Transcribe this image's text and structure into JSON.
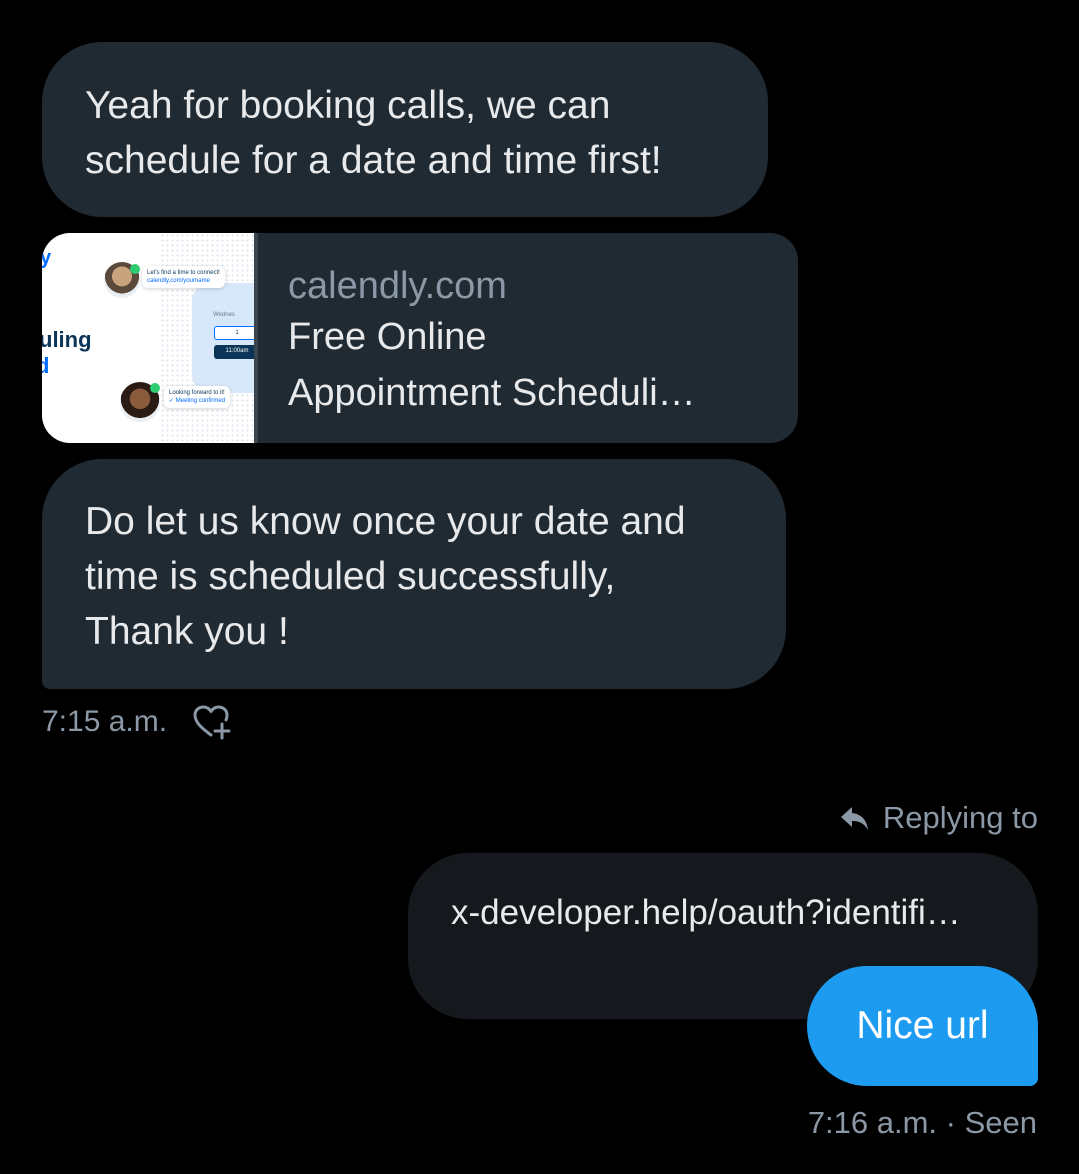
{
  "conversation": {
    "incoming": [
      {
        "text": "Yeah for booking calls, we can\nschedule for a date and time first!"
      },
      {
        "text": "Do let us know once your date and\ntime is scheduled successfully,\nThank you !"
      }
    ],
    "link_preview": {
      "domain": "calendly.com",
      "title": "Free Online\nAppointment Scheduli…",
      "thumbnail": {
        "word_fragment_top": "y",
        "word_fragment_mid": "uling",
        "word_fragment_low": "d",
        "bubble_top_line1": "Let's find a time to connect!",
        "bubble_top_line2": "calendly.com/yourname",
        "bubble_bottom_line1": "Looking forward to it!",
        "bubble_bottom_line2": "Meeting confirmed",
        "calendar_day": "Wednes",
        "slot_1": "1",
        "slot_2": "11:00am"
      }
    },
    "incoming_time": "7:15 a.m.",
    "reply": {
      "replying_label": "Replying to",
      "quoted_text": "x-developer.help/oauth?identifi…"
    },
    "outgoing": {
      "text": "Nice url",
      "meta": "7:16 a.m. · Seen"
    }
  },
  "colors": {
    "background": "#000000",
    "incoming_bubble": "#202a33",
    "quoted_bubble": "#15191d",
    "outgoing_bubble": "#1d9bf0",
    "muted_text": "#8b98a5",
    "primary_text": "#e7e9ea"
  },
  "icons": {
    "react": "heart-plus-icon",
    "reply": "reply-arrow-icon"
  }
}
